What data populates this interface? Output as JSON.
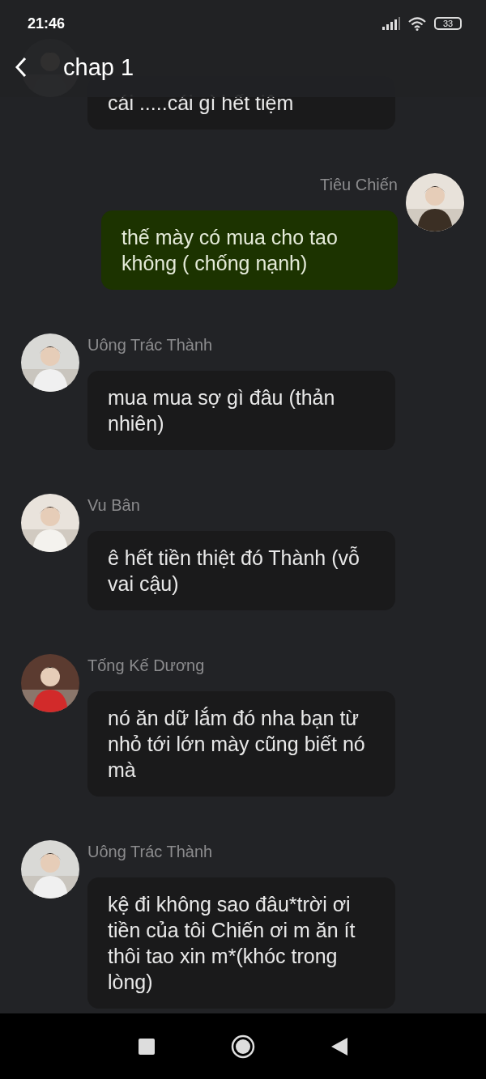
{
  "status_bar": {
    "time": "21:46",
    "battery": "33"
  },
  "header": {
    "title": "chap 1"
  },
  "messages": [
    {
      "kind": "incoming",
      "text": "cái .....cái gì hết tiệm"
    },
    {
      "kind": "outgoing",
      "sender": "Tiêu Chiến",
      "text": "thế mày có mua cho tao không ( chống nạnh)"
    },
    {
      "kind": "incoming",
      "sender": "Uông Trác Thành",
      "text": "mua mua sợ gì đâu (thản nhiên)"
    },
    {
      "kind": "incoming",
      "sender": "Vu Bân",
      "text": "ê hết tiền thiệt đó Thành (vỗ vai cậu)"
    },
    {
      "kind": "incoming",
      "sender": "Tống Kế Dương",
      "text": "nó ăn dữ lắm đó nha bạn từ nhỏ tới lớn mày cũng biết nó mà"
    },
    {
      "kind": "incoming",
      "sender": "Uông Trác Thành",
      "text": "kệ đi không sao đâu*trời ơi tiền của tôi Chiến ơi m ăn ít thôi tao xin m*(khóc trong lòng)"
    }
  ]
}
